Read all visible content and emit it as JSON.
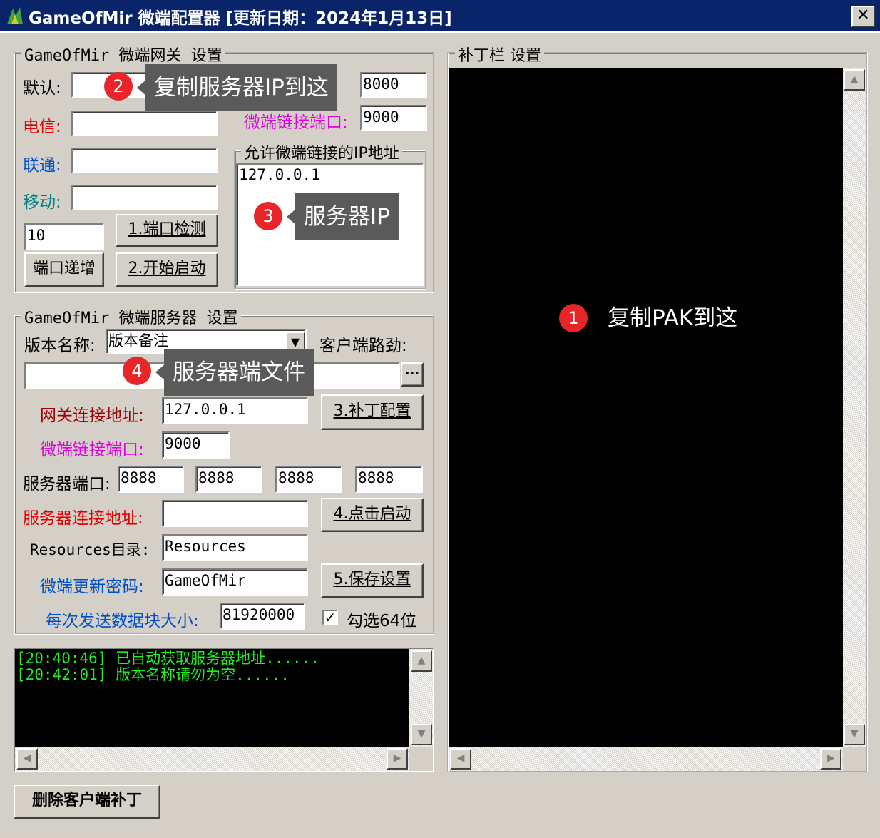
{
  "window": {
    "title": "GameOfMir 微端配置器 [更新日期：2024年1月13日]",
    "close_glyph": "✕"
  },
  "gateway": {
    "group_title": "GameOfMir 微端网关  设置",
    "default_label": "默认:",
    "default_value": "",
    "telecom_label": "电信:",
    "telecom_value": "",
    "unicom_label": "联通:",
    "unicom_value": "",
    "mobile_label": "移动:",
    "mobile_value": "",
    "port_value_1": "8000",
    "micro_port_label": "微端链接端口:",
    "micro_port_value": "9000",
    "allow_ip_group_title": "允许微端链接的IP地址",
    "allow_ip_value": "127.0.0.1",
    "increment_value": "10",
    "port_check_button": "1.端口检测",
    "port_increment_button": "端口递增",
    "start_button": "2.开始启动"
  },
  "server": {
    "group_title": "GameOfMir 微端服务器  设置",
    "version_label": "版本名称:",
    "version_value": "版本备注",
    "client_path_label": "客户端路劲:",
    "client_path_value": "",
    "browse_button": "···",
    "gateway_addr_label": "网关连接地址:",
    "gateway_addr_value": "127.0.0.1",
    "patch_config_button": "3.补丁配置",
    "micro_port_label": "微端链接端口:",
    "micro_port_value": "9000",
    "server_port_label": "服务器端口:",
    "server_ports": [
      "8888",
      "8888",
      "8888",
      "8888"
    ],
    "server_addr_label": "服务器连接地址:",
    "server_addr_value": "",
    "click_start_button": "4.点击启动",
    "resources_label": "Resources目录:",
    "resources_value": "Resources",
    "password_label": "微端更新密码:",
    "password_value": "GameOfMir",
    "save_button": "5.保存设置",
    "chunk_label": "每次发送数据块大小:",
    "chunk_value": "81920000",
    "x64_label": "勾选64位",
    "x64_checked": "✓"
  },
  "log": {
    "lines": [
      "[20:40:46] 已自动获取服务器地址......",
      "[20:42:01] 版本名称请勿为空......"
    ]
  },
  "patch_panel": {
    "group_title": "补丁栏  设置"
  },
  "delete_patch_button": "删除客户端补丁",
  "callouts": [
    {
      "number": "1",
      "text": "复制PAK到这"
    },
    {
      "number": "2",
      "text": "复制服务器IP到这"
    },
    {
      "number": "3",
      "text": "服务器IP"
    },
    {
      "number": "4",
      "text": "服务器端文件"
    }
  ],
  "colors": {
    "titlebar": "#0a246a",
    "red_label": "#e00000",
    "blue_label": "#0050c8",
    "teal_label": "#008080",
    "magenta_label": "#e000e0",
    "dark_red_label": "#a00000",
    "log_text": "#22ee22",
    "badge": "#e8262a"
  }
}
